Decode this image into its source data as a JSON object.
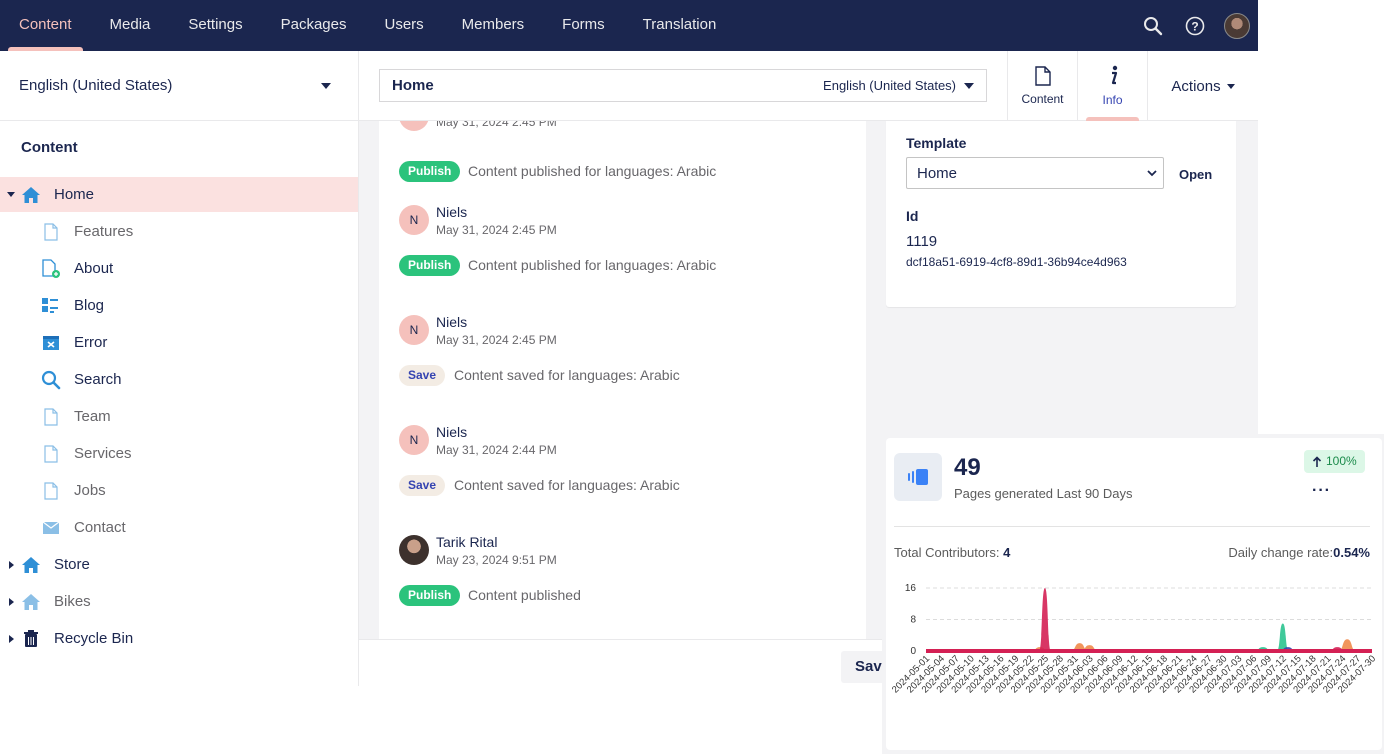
{
  "topnav": {
    "items": [
      "Content",
      "Media",
      "Settings",
      "Packages",
      "Users",
      "Members",
      "Forms",
      "Translation"
    ],
    "active_index": 0,
    "icons": [
      "search-icon",
      "help-icon",
      "user-avatar"
    ]
  },
  "sidebar": {
    "language": "English (United States)",
    "section_title": "Content",
    "tree": [
      {
        "label": "Home",
        "icon": "home-icon",
        "expanded": true,
        "selected": true
      },
      {
        "label": "Features",
        "icon": "document-icon",
        "muted": true
      },
      {
        "label": "About",
        "icon": "document-add-icon"
      },
      {
        "label": "Blog",
        "icon": "blog-icon"
      },
      {
        "label": "Error",
        "icon": "error-icon"
      },
      {
        "label": "Search",
        "icon": "search-icon"
      },
      {
        "label": "Team",
        "icon": "document-icon",
        "muted": true
      },
      {
        "label": "Services",
        "icon": "document-icon",
        "muted": true
      },
      {
        "label": "Jobs",
        "icon": "document-icon",
        "muted": true
      },
      {
        "label": "Contact",
        "icon": "mail-icon",
        "muted": true
      },
      {
        "label": "Store",
        "icon": "home-icon"
      },
      {
        "label": "Bikes",
        "icon": "home-icon",
        "muted": true
      },
      {
        "label": "Recycle Bin",
        "icon": "trash-icon"
      }
    ]
  },
  "editor": {
    "node_name": "Home",
    "node_language": "English (United States)",
    "tabs": [
      {
        "label": "Content",
        "icon": "document-icon"
      },
      {
        "label": "Info",
        "icon": "info-icon",
        "active": true
      }
    ],
    "actions_label": "Actions"
  },
  "history": {
    "partial_date": "May 31, 2024 2:45 PM",
    "entries": [
      {
        "badge": "Publish",
        "type": "publish",
        "message": "Content published for languages: Arabic"
      },
      {
        "user": "Niels",
        "initial": "N",
        "date": "May 31, 2024 2:45 PM",
        "badge": "Publish",
        "type": "publish",
        "message": "Content published for languages: Arabic"
      },
      {
        "user": "Niels",
        "initial": "N",
        "date": "May 31, 2024 2:45 PM",
        "badge": "Save",
        "type": "save",
        "message": "Content saved for languages: Arabic"
      },
      {
        "user": "Niels",
        "initial": "N",
        "date": "May 31, 2024 2:44 PM",
        "badge": "Save",
        "type": "save",
        "message": "Content saved for languages: Arabic"
      },
      {
        "user": "Tarik Rital",
        "initial": "",
        "date": "May 23, 2024 9:51 PM",
        "badge": "Publish",
        "type": "publish",
        "message": "Content published"
      }
    ]
  },
  "info": {
    "template_label": "Template",
    "template_value": "Home",
    "open_label": "Open",
    "id_label": "Id",
    "id_value": "1119",
    "guid": "dcf18a51-6919-4cf8-89d1-36b94ce4d963"
  },
  "footer": {
    "save_label": "Save"
  },
  "widget": {
    "value": "49",
    "caption": "Pages generated Last 90 Days",
    "change": "100%",
    "more": "···",
    "contributors_label": "Total Contributors:",
    "contributors_value": "4",
    "rate_label": "Daily change rate:",
    "rate_value": "0.54%"
  },
  "chart_data": {
    "type": "area",
    "ylim": [
      0,
      16
    ],
    "yticks": [
      0,
      8,
      16
    ],
    "grid": true,
    "xticks": [
      "2024-05-01",
      "2024-05-04",
      "2024-05-07",
      "2024-05-10",
      "2024-05-13",
      "2024-05-16",
      "2024-05-19",
      "2024-05-22",
      "2024-05-25",
      "2024-05-28",
      "2024-05-31",
      "2024-06-03",
      "2024-06-06",
      "2024-06-09",
      "2024-06-12",
      "2024-06-15",
      "2024-06-18",
      "2024-06-21",
      "2024-06-24",
      "2024-06-27",
      "2024-06-30",
      "2024-07-03",
      "2024-07-06",
      "2024-07-09",
      "2024-07-12",
      "2024-07-15",
      "2024-07-18",
      "2024-07-21",
      "2024-07-24",
      "2024-07-27",
      "2024-07-30"
    ],
    "series": [
      {
        "color": "#2bc38f",
        "points": [
          [
            "2024-07-08",
            1
          ],
          [
            "2024-07-12",
            7
          ]
        ]
      },
      {
        "color": "#3544b1",
        "points": [
          [
            "2024-07-13",
            1
          ],
          [
            "2024-07-24",
            0.5
          ]
        ]
      },
      {
        "color": "#f0894a",
        "points": [
          [
            "2024-05-24",
            1
          ],
          [
            "2024-06-01",
            2
          ],
          [
            "2024-06-03",
            1.5
          ],
          [
            "2024-07-25",
            3
          ]
        ]
      },
      {
        "color": "#d42054",
        "points": [
          [
            "2024-05-25",
            16
          ],
          [
            "2024-07-23",
            1
          ]
        ]
      }
    ]
  }
}
